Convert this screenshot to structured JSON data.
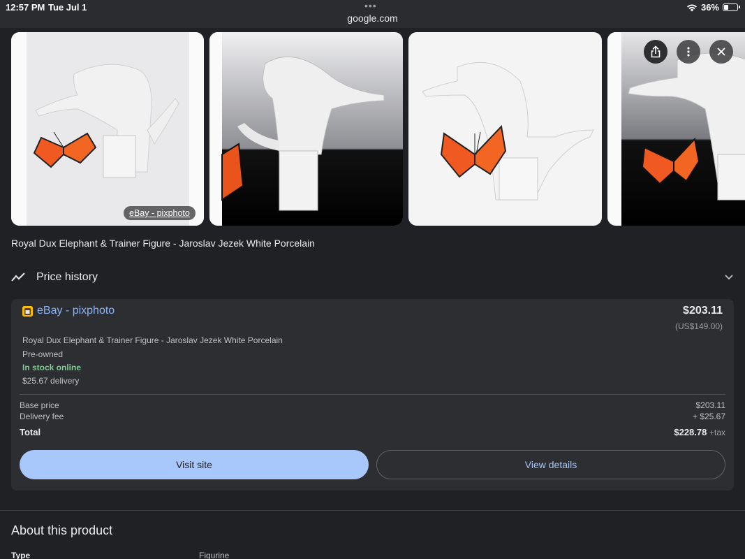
{
  "status_bar": {
    "time": "12:57 PM",
    "date": "Tue Jul 1",
    "url": "google.com",
    "battery": "36%",
    "battery_level": 0.36,
    "dots": "•••"
  },
  "images": {
    "source_chip": "eBay - pixphoto"
  },
  "product": {
    "title": "Royal Dux Elephant & Trainer Figure - Jaroslav Jezek White Porcelain"
  },
  "price_history": {
    "label": "Price history"
  },
  "offer": {
    "store": "eBay - pixphoto",
    "price": "$203.11",
    "price_usd": "(US$149.00)",
    "description": "Royal Dux Elephant & Trainer Figure - Jaroslav Jezek White Porcelain",
    "condition": "Pre-owned",
    "stock": "In stock online",
    "delivery": "$25.67 delivery",
    "base_price_label": "Base price",
    "base_price": "$203.11",
    "delivery_fee_label": "Delivery fee",
    "delivery_fee": "+ $25.67",
    "total_label": "Total",
    "total": "$228.78",
    "tax": "+tax",
    "visit_label": "Visit site",
    "details_label": "View details"
  },
  "about": {
    "heading": "About this product",
    "type_label": "Type",
    "type_value": "Figurine"
  },
  "colors": {
    "background": "#202124",
    "card": "#2d2e31",
    "link": "#8ab4f8",
    "primary_button": "#a8c7fa",
    "in_stock": "#81c995"
  }
}
